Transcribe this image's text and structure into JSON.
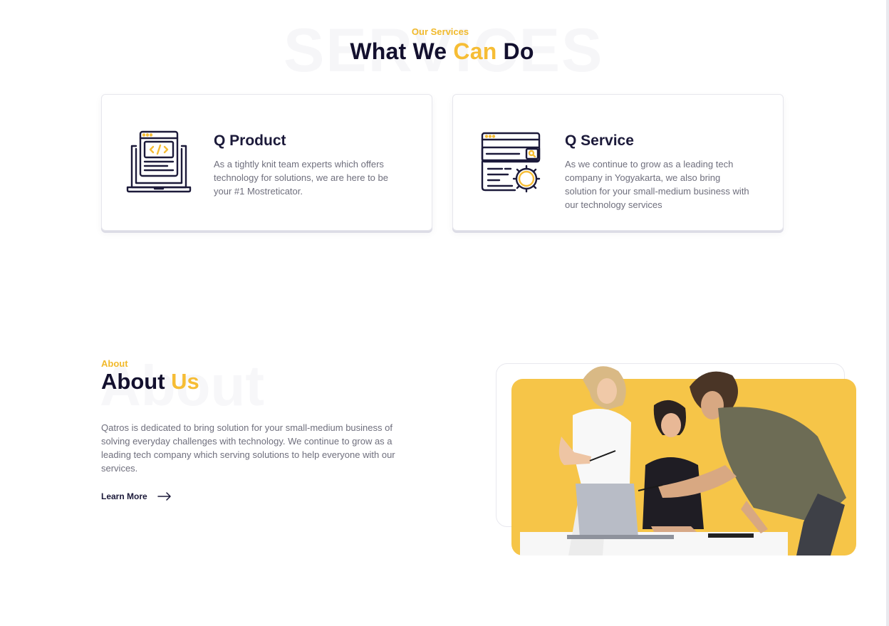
{
  "services": {
    "ghost_text": "SERVICES",
    "eyebrow": "Our Services",
    "title_part1": "What We ",
    "title_accent": "Can",
    "title_part2": " Do",
    "cards": [
      {
        "icon": "code-laptop-icon",
        "title": "Q Product",
        "text": "As a tightly knit team experts which offers technology for solutions, we are here to be your #1 Mostreticator."
      },
      {
        "icon": "browser-gear-icon",
        "title": "Q Service",
        "text": "As we continue to grow as a leading tech company in Yogyakarta, we also  bring solution for your small-medium business with our technology services"
      }
    ]
  },
  "about": {
    "ghost_text": "About",
    "eyebrow": "About",
    "title_part1": "About ",
    "title_accent": "Us",
    "text": "Qatros is dedicated to bring solution for your small-medium business of solving everyday challenges with technology. We continue to grow as a leading tech company which serving solutions to help everyone with our services.",
    "learn_more": "Learn More",
    "learn_more_icon": "arrow-right-icon"
  },
  "colors": {
    "accent": "#f6bd35",
    "heading": "#13102e",
    "body_text": "#6f6f7d",
    "photo_bg": "#f6c548"
  }
}
